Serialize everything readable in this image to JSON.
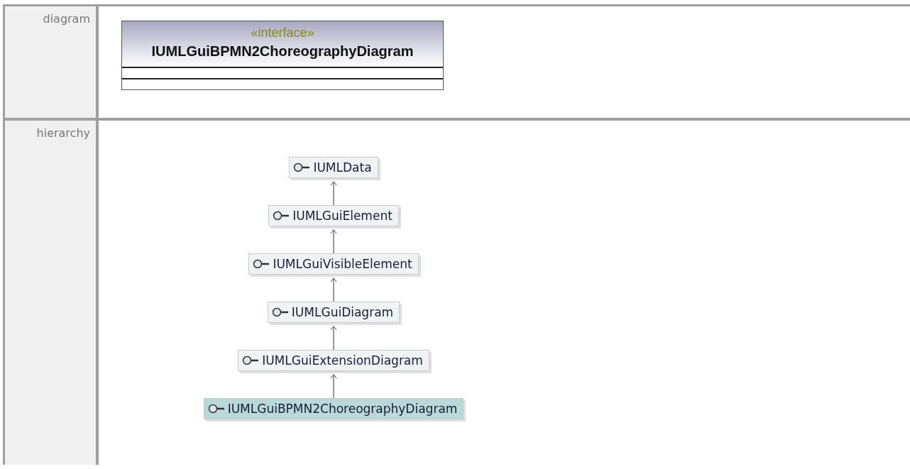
{
  "rows": [
    {
      "kind": "diagram",
      "label": "diagram",
      "class_box": {
        "stereotype": "«interface»",
        "name": "IUMLGuiBPMN2ChoreographyDiagram"
      }
    },
    {
      "kind": "hierarchy",
      "label": "hierarchy",
      "nodes": [
        {
          "name": "IUMLData",
          "selected": false
        },
        {
          "name": "IUMLGuiElement",
          "selected": false
        },
        {
          "name": "IUMLGuiVisibleElement",
          "selected": false
        },
        {
          "name": "IUMLGuiDiagram",
          "selected": false
        },
        {
          "name": "IUMLGuiExtensionDiagram",
          "selected": false
        },
        {
          "name": "IUMLGuiBPMN2ChoreographyDiagram",
          "selected": true
        }
      ]
    }
  ]
}
